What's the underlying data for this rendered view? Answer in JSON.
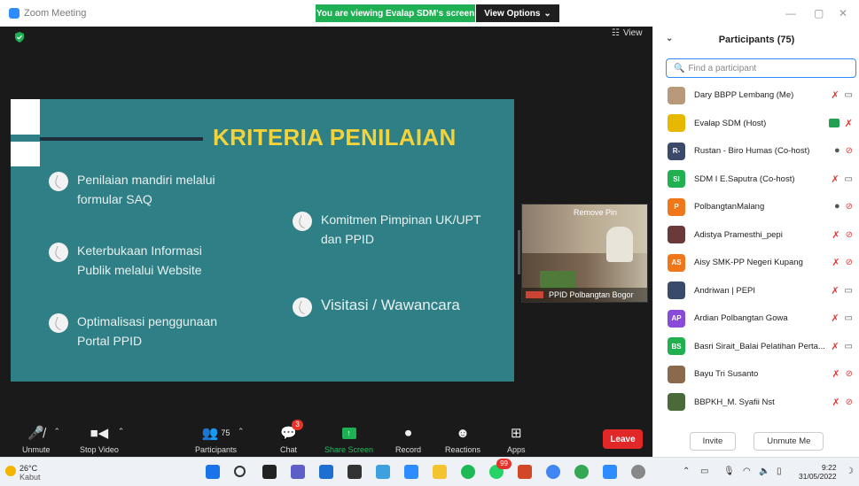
{
  "window": {
    "title": "Zoom Meeting"
  },
  "banner": {
    "viewing": "You are viewing Evalap SDM's screen",
    "view_options": "View Options"
  },
  "stage": {
    "view_label": "View"
  },
  "slide": {
    "title": "KRITERIA PENILAIAN",
    "bullets_left": [
      {
        "line1": "Penilaian mandiri melalui",
        "line2": "formular SAQ"
      },
      {
        "line1": "Keterbukaan Informasi",
        "line2": "Publik melalui Website"
      },
      {
        "line1": "Optimalisasi penggunaan",
        "line2": "Portal PPID"
      }
    ],
    "bullets_right": [
      {
        "line1": "Komitmen Pimpinan UK/UPT",
        "line2": "dan PPID"
      },
      {
        "line1": "Visitasi / Wawancara",
        "line2": ""
      }
    ]
  },
  "video_tile": {
    "name": "PPID Polbangtan Bogor",
    "overlay": "Remove Pin"
  },
  "toolbar": {
    "unmute": "Unmute",
    "stop_video": "Stop Video",
    "participants": "Participants",
    "participants_count": "75",
    "chat": "Chat",
    "chat_badge": "3",
    "share_screen": "Share Screen",
    "record": "Record",
    "reactions": "Reactions",
    "apps": "Apps",
    "leave": "Leave"
  },
  "panel": {
    "title": "Participants (75)",
    "search_placeholder": "Find a participant",
    "invite": "Invite",
    "unmute_me": "Unmute Me",
    "participants": [
      {
        "name": "Dary BBPP Lembang (Me)",
        "initials": "",
        "color": "#b89a7a",
        "mic": "off",
        "video": "on"
      },
      {
        "name": "Evalap SDM (Host)",
        "initials": "",
        "color": "#e6b800",
        "mic": "off",
        "video": "share"
      },
      {
        "name": "Rustan - Biro Humas (Co-host)",
        "initials": "R-",
        "color": "#3b4a6b",
        "mic": "on",
        "video": "off"
      },
      {
        "name": "SDM I E.Saputra (Co-host)",
        "initials": "SI",
        "color": "#20b050",
        "mic": "off",
        "video": "on"
      },
      {
        "name": "PolbangtanMalang",
        "initials": "P",
        "color": "#f0761a",
        "mic": "on",
        "video": "off"
      },
      {
        "name": "Adistya Pramesthi_pepi",
        "initials": "",
        "color": "#6a3a3a",
        "mic": "off",
        "video": "off"
      },
      {
        "name": "Aisy SMK-PP Negeri Kupang",
        "initials": "AS",
        "color": "#f0761a",
        "mic": "off",
        "video": "off"
      },
      {
        "name": "Andriwan | PEPI",
        "initials": "",
        "color": "#3a4a6a",
        "mic": "off",
        "video": "on"
      },
      {
        "name": "Ardian Polbangtan Gowa",
        "initials": "AP",
        "color": "#8a4bd8",
        "mic": "off",
        "video": "on"
      },
      {
        "name": "Basri Sirait_Balai Pelatihan Perta...",
        "initials": "BS",
        "color": "#20b050",
        "mic": "off",
        "video": "on"
      },
      {
        "name": "Bayu Tri Susanto",
        "initials": "",
        "color": "#8a6a4a",
        "mic": "off",
        "video": "off"
      },
      {
        "name": "BBPKH_M. Syafii Nst",
        "initials": "",
        "color": "#4a6a3a",
        "mic": "off",
        "video": "off"
      }
    ]
  },
  "taskbar": {
    "temp": "26°C",
    "weather": "Kabut",
    "time": "9:22",
    "date": "31/05/2022",
    "notif_badge": "99"
  },
  "colors": {
    "slide_bg": "#2f8086",
    "slide_title": "#f3d23a",
    "zoom_blue": "#2d8cff",
    "leave_red": "#e02828",
    "share_green": "#20b054"
  }
}
